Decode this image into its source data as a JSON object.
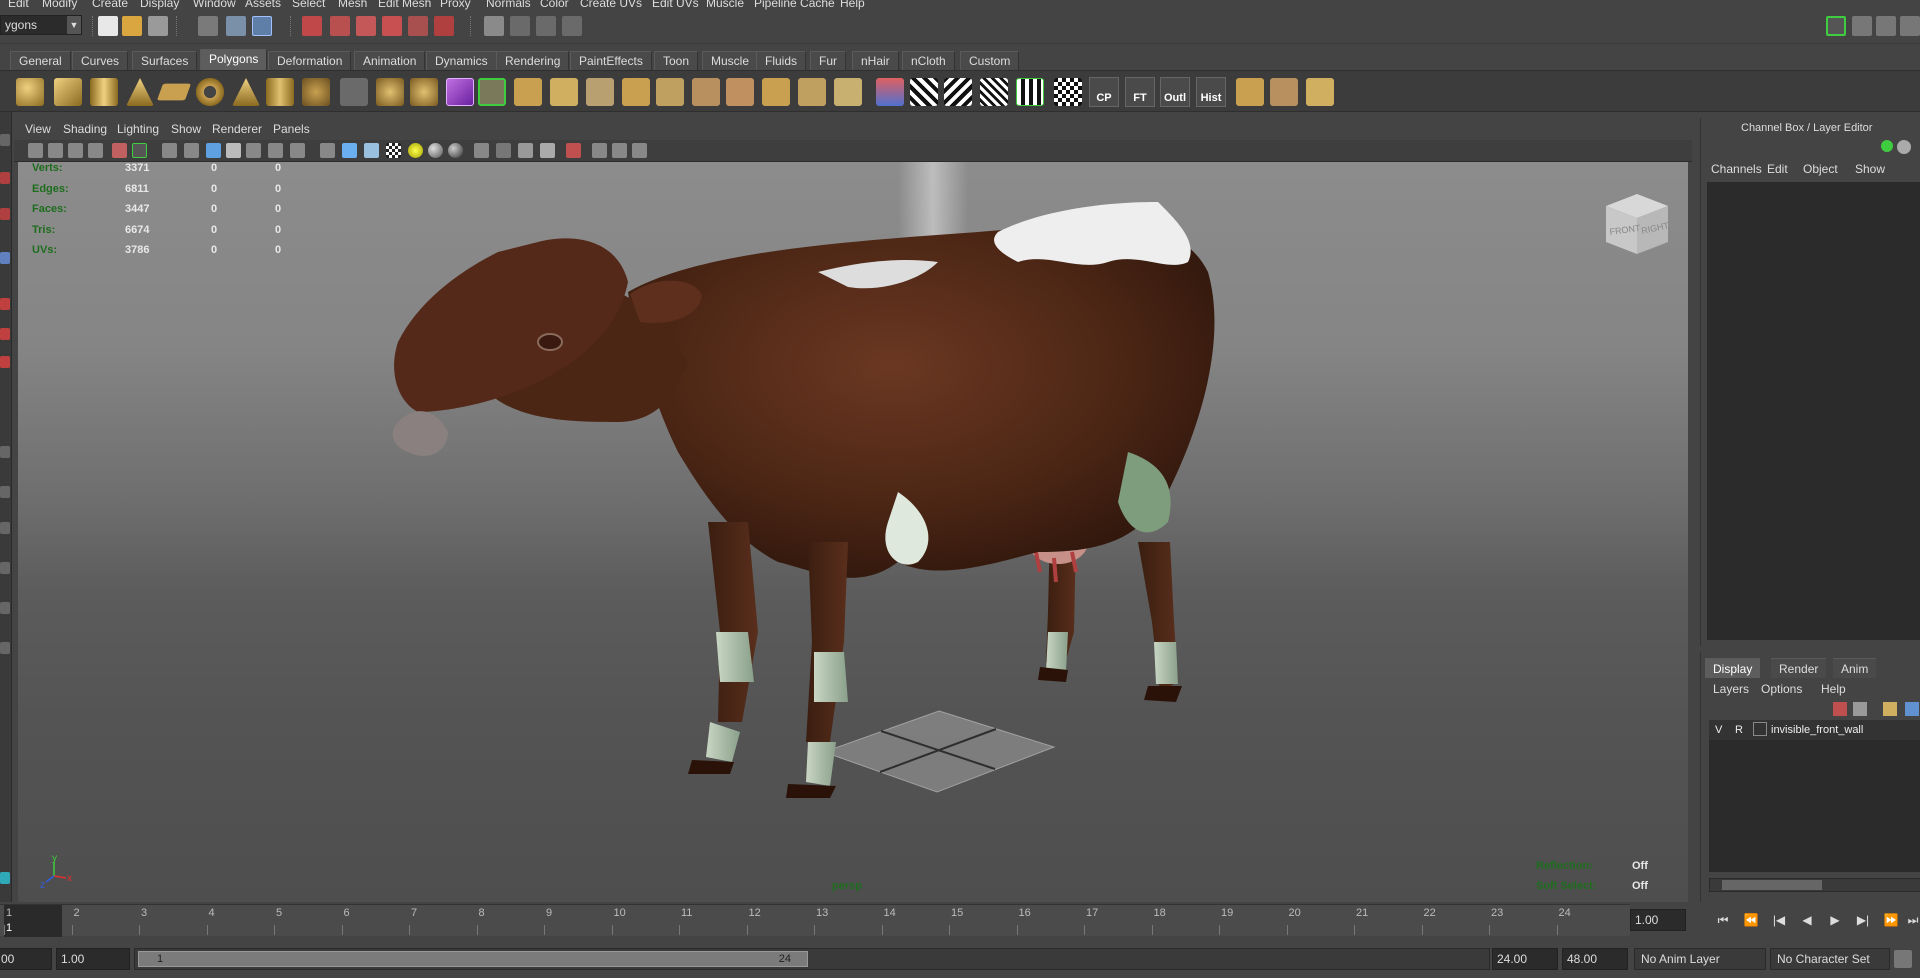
{
  "menubar": {
    "items": [
      "Edit",
      "Modify",
      "Create",
      "Display",
      "Window",
      "Assets",
      "Select",
      "Mesh",
      "Edit Mesh",
      "Proxy",
      "Normals",
      "Color",
      "Create UVs",
      "Edit UVs",
      "Muscle",
      "Pipeline Cache",
      "Help"
    ]
  },
  "statusline": {
    "mode_value": "ygons"
  },
  "shelf": {
    "tabs": [
      "General",
      "Curves",
      "Surfaces",
      "Polygons",
      "Deformation",
      "Animation",
      "Dynamics",
      "Rendering",
      "PaintEffects",
      "Toon",
      "Muscle",
      "Fluids",
      "Fur",
      "nHair",
      "nCloth",
      "Custom"
    ],
    "active_tab": "Polygons",
    "text_buttons": [
      "CP",
      "FT",
      "Outl",
      "Hist"
    ]
  },
  "panel": {
    "menu": [
      "View",
      "Shading",
      "Lighting",
      "Show",
      "Renderer",
      "Panels"
    ]
  },
  "hud": {
    "stats": [
      {
        "label": "Verts:",
        "values": [
          "3371",
          "0",
          "0"
        ]
      },
      {
        "label": "Edges:",
        "values": [
          "6811",
          "0",
          "0"
        ]
      },
      {
        "label": "Faces:",
        "values": [
          "3447",
          "0",
          "0"
        ]
      },
      {
        "label": "Tris:",
        "values": [
          "6674",
          "0",
          "0"
        ]
      },
      {
        "label": "UVs:",
        "values": [
          "3786",
          "0",
          "0"
        ]
      }
    ],
    "camera_name": "persp",
    "reflection_label": "Reflection:",
    "reflection_value": "Off",
    "soft_select_label": "Soft Select:",
    "soft_select_value": "Off",
    "viewcube_front": "FRONT",
    "viewcube_right": "RIGHT",
    "axis_y": "y",
    "axis_x": "x",
    "axis_z": "z"
  },
  "channel_box": {
    "title": "Channel Box / Layer Editor",
    "menu": [
      "Channels",
      "Edit",
      "Object",
      "Show"
    ]
  },
  "layer_editor": {
    "tabs": [
      "Display",
      "Render",
      "Anim"
    ],
    "active_tab": "Display",
    "menu": [
      "Layers",
      "Options",
      "Help"
    ],
    "layers": [
      {
        "v": "V",
        "r": "R",
        "name": "invisible_front_wall"
      }
    ]
  },
  "time_slider": {
    "current_frame_marker": "1",
    "ticks": [
      "1",
      "2",
      "3",
      "4",
      "5",
      "6",
      "7",
      "8",
      "9",
      "10",
      "11",
      "12",
      "13",
      "14",
      "15",
      "16",
      "17",
      "18",
      "19",
      "20",
      "21",
      "22",
      "23",
      "24"
    ],
    "current_time": "1.00"
  },
  "range_slider": {
    "start_time": "1.00",
    "start_field_partial": "00",
    "range_start_label": "1",
    "range_end_label": "24",
    "end_time": "24.00",
    "anim_end_time": "48.00",
    "anim_layer": "No Anim Layer",
    "character_set": "No Character Set"
  },
  "colors": {
    "hud_label": "#1d6d1d",
    "cow_body": "#5a2e1c",
    "accent_active_tab": "#5d5d5d"
  }
}
